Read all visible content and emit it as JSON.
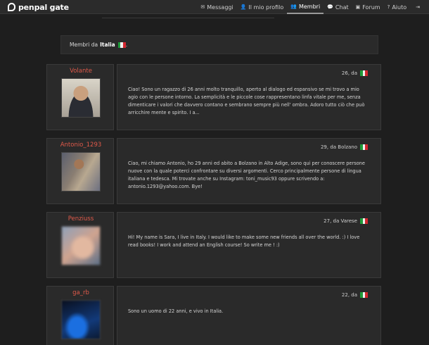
{
  "brand": {
    "name": "penpal gate"
  },
  "nav": {
    "items": [
      {
        "icon": "✉",
        "label": "Messaggi"
      },
      {
        "icon": "👤",
        "label": "Il mio profilo"
      },
      {
        "icon": "👥",
        "label": "Membri",
        "active": true
      },
      {
        "icon": "💬",
        "label": "Chat"
      },
      {
        "icon": "▣",
        "label": "Forum"
      },
      {
        "icon": "?",
        "label": "Aiuto"
      }
    ],
    "logout_icon": "⇥"
  },
  "header": {
    "prefix": "Membri da",
    "country": "Italia",
    "suffix": "."
  },
  "members": [
    {
      "username": "Volante",
      "meta": "26, da",
      "text": "Ciao! Sono un ragazzo di 26 anni molto tranquillo, aperto al dialogo ed espansivo se mi trovo a mio agio con le persone intorno. La semplicità e le piccole cose rappresentano linfa vitale per me, senza dimenticare i valori che davvero contano e sembrano sempre più nell' ombra. Adoro tutto ciò che può arricchire mente e spirito. I a..."
    },
    {
      "username": "Antonio_1293",
      "meta": "29, da Bolzano",
      "text": "Ciao, mi chiamo Antonio, ho 29 anni ed abito a Bolzano in Alto Adige, sono qui per conoscere persone nuove con la quale poterci confrontare su diversi argomenti. Cerco principalmente persone di lingua italiana e tedesca. Mi trovate anche su Instagram: toni_music93 oppure scrivendo a: antonio.1293@yahoo.com. Bye!"
    },
    {
      "username": "Penziuss",
      "meta": "27, da Varese",
      "text": "Hi! My name is Sara, I live in Italy. I would like to make some new friends all over the world. :) I love read books! I work and attend an English course! So write me ! :)"
    },
    {
      "username": "ga_rb",
      "meta": "22, da",
      "text": "Sono un uomo di 22 anni, e vivo in Italia."
    }
  ]
}
